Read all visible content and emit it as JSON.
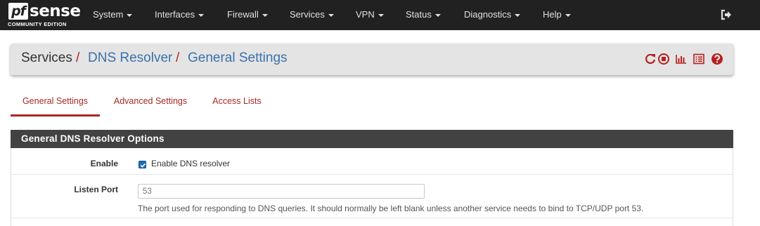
{
  "brand": {
    "logo_pf": "pf",
    "logo_sense": "sense",
    "edition": "COMMUNITY EDITION"
  },
  "nav": {
    "items": [
      {
        "label": "System"
      },
      {
        "label": "Interfaces"
      },
      {
        "label": "Firewall"
      },
      {
        "label": "Services"
      },
      {
        "label": "VPN"
      },
      {
        "label": "Status"
      },
      {
        "label": "Diagnostics"
      },
      {
        "label": "Help"
      }
    ],
    "logout_icon": "sign-out-icon"
  },
  "breadcrumb": {
    "root": "Services",
    "separator": "/",
    "level1": "DNS Resolver",
    "level2": "General Settings",
    "icons": [
      "restart-icon",
      "stop-icon",
      "bar-chart-icon",
      "log-list-icon",
      "help-icon"
    ]
  },
  "tabs": [
    {
      "label": "General Settings",
      "active": true
    },
    {
      "label": "Advanced Settings",
      "active": false
    },
    {
      "label": "Access Lists",
      "active": false
    }
  ],
  "panel": {
    "title": "General DNS Resolver Options",
    "enable": {
      "label": "Enable",
      "checkbox_label": "Enable DNS resolver",
      "checked": true
    },
    "listen_port": {
      "label": "Listen Port",
      "placeholder": "53",
      "value": "",
      "help": "The port used for responding to DNS queries. It should normally be left blank unless another service needs to bind to TCP/UDP port 53."
    }
  },
  "colors": {
    "navbar_bg": "#212121",
    "accent_red": "#a52828",
    "link_blue": "#3a72ad",
    "panel_heading_bg": "#424242",
    "breadcrumb_bg": "#e4e4e4",
    "checkbox_blue": "#1d6eb5"
  }
}
